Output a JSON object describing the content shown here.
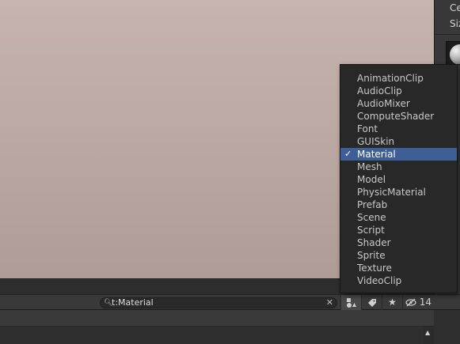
{
  "inspector": {
    "label1": "Ce",
    "label2": "Siz"
  },
  "search": {
    "value": "t:Material",
    "icon": "search-icon",
    "clear_icon": "close-icon"
  },
  "toolbar": {
    "hidden_count": "14",
    "icons": [
      "filter-by-type-icon",
      "label-icon",
      "star-icon",
      "eye-slash-icon"
    ]
  },
  "type_menu": {
    "selected": "Material",
    "check_mark": "✓",
    "items": [
      "AnimationClip",
      "AudioClip",
      "AudioMixer",
      "ComputeShader",
      "Font",
      "GUISkin",
      "Material",
      "Mesh",
      "Model",
      "PhysicMaterial",
      "Prefab",
      "Scene",
      "Script",
      "Shader",
      "Sprite",
      "Texture",
      "VideoClip"
    ]
  },
  "colors": {
    "selection": "#3e5f96",
    "scene_background": "#bda9a3"
  }
}
